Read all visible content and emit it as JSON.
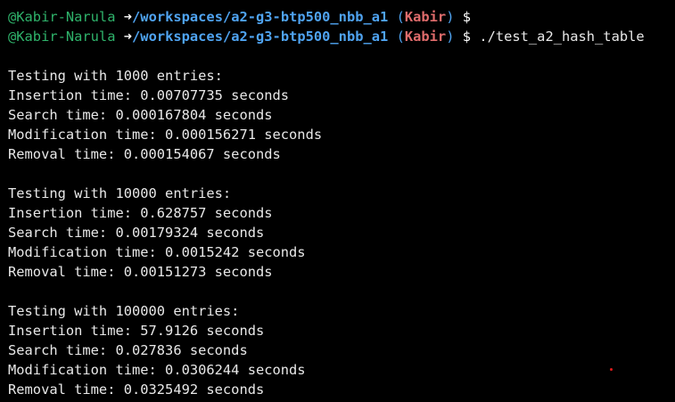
{
  "prompt": {
    "user": "@Kabir-Narula",
    "arrow": "➜",
    "path": "/workspaces/a2-g3-btp500_nbb_a1",
    "open_paren": "(",
    "branch": "Kabir",
    "close_paren": ")",
    "symbol": "$"
  },
  "command": "./test_a2_hash_table",
  "results": [
    {
      "header": "Testing with 1000 entries:",
      "lines": [
        "Insertion time: 0.00707735 seconds",
        "Search time: 0.000167804 seconds",
        "Modification time: 0.000156271 seconds",
        "Removal time: 0.000154067 seconds"
      ]
    },
    {
      "header": "Testing with 10000 entries:",
      "lines": [
        "Insertion time: 0.628757 seconds",
        "Search time: 0.00179324 seconds",
        "Modification time: 0.0015242 seconds",
        "Removal time: 0.00151273 seconds"
      ]
    },
    {
      "header": "Testing with 100000 entries:",
      "lines": [
        "Insertion time: 57.9126 seconds",
        "Search time: 0.027836 seconds",
        "Modification time: 0.0306244 seconds",
        "Removal time: 0.0325492 seconds"
      ]
    }
  ],
  "colors": {
    "background": "#000000",
    "user": "#2fb36b",
    "path": "#4fa3f0",
    "branch": "#e06c6c",
    "text": "#e8e8e8"
  }
}
